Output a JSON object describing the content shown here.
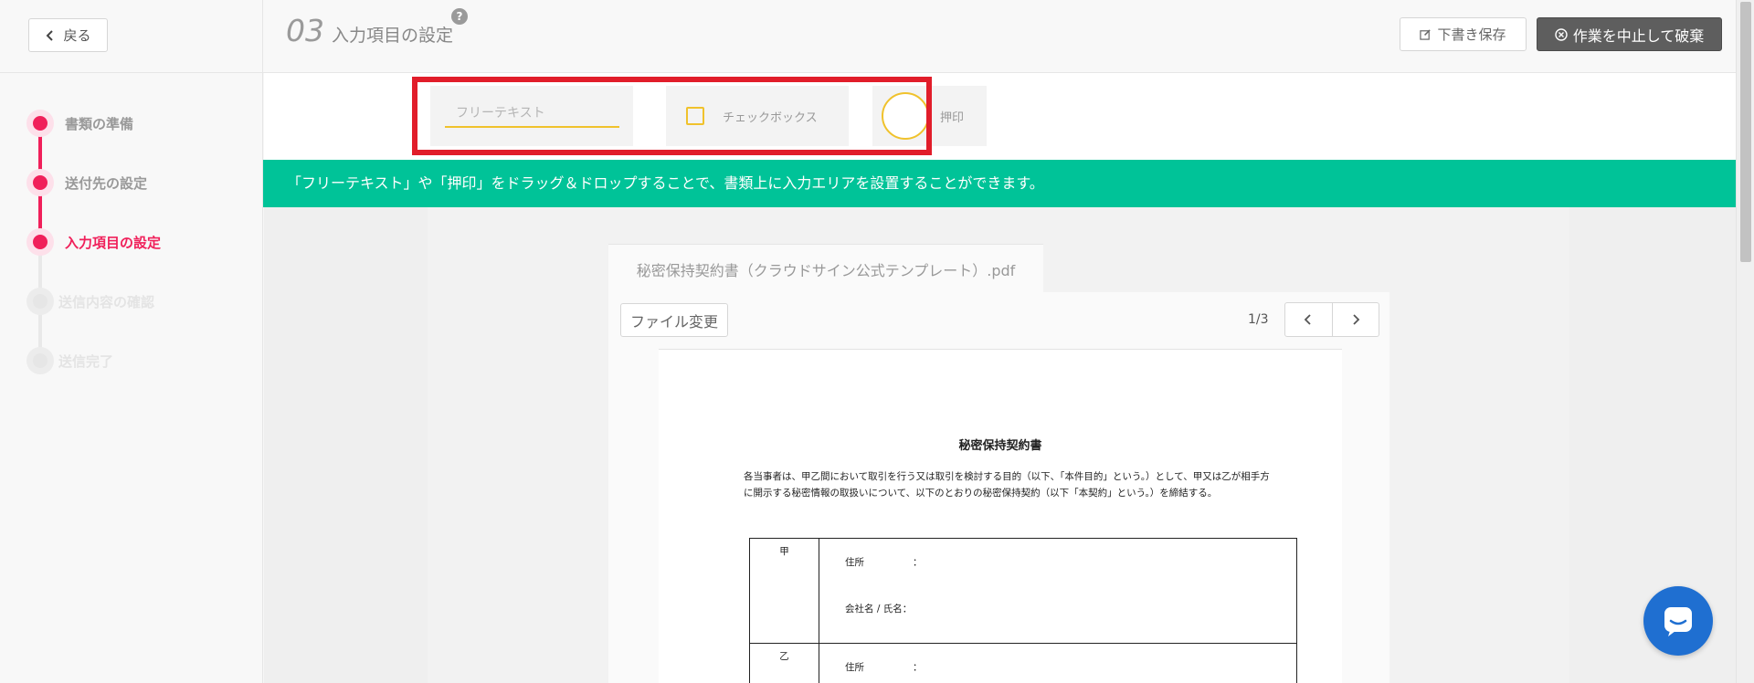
{
  "header": {
    "back_label": "戻る",
    "step_number": "03",
    "step_title": "入力項目の設定",
    "help": "?",
    "draft_label": "下書き保存",
    "abort_label": "作業を中止して破棄"
  },
  "sidebar": {
    "steps": [
      {
        "label": "書類の準備",
        "state": "done"
      },
      {
        "label": "送付先の設定",
        "state": "done"
      },
      {
        "label": "入力項目の設定",
        "state": "current"
      },
      {
        "label": "送信内容の確認",
        "state": "pending"
      },
      {
        "label": "送信完了",
        "state": "pending"
      }
    ]
  },
  "tools": {
    "free_text_placeholder": "フリーテキスト",
    "checkbox_label": "チェックボックス",
    "stamp_label": "押印"
  },
  "banner_text": "「フリーテキスト」や「押印」をドラッグ＆ドロップすることで、書類上に入力エリアを設置することができます。",
  "document": {
    "file_name": "秘密保持契約書（クラウドサイン公式テンプレート）.pdf",
    "file_change_label": "ファイル変更",
    "page_indicator": "1/3",
    "title": "秘密保持契約書",
    "body": "各当事者は、甲乙間において取引を行う又は取引を検討する目的（以下、「本件目的」という。）として、甲又は乙が相手方に開示する秘密情報の取扱いについて、以下のとおりの秘密保持契約（以下「本契約」という。）を締結する。",
    "parties": [
      {
        "head": "甲",
        "address_label": "住所",
        "name_label": "会社名 / 氏名",
        "colon": "："
      },
      {
        "head": "乙",
        "address_label": "住所",
        "colon": "："
      }
    ]
  },
  "colors": {
    "accent_pink": "#f0205a",
    "banner_green": "#00c398",
    "highlight_red": "#e11d2a",
    "tool_yellow": "#f0c22c",
    "chat_blue": "#1f6fd1"
  }
}
